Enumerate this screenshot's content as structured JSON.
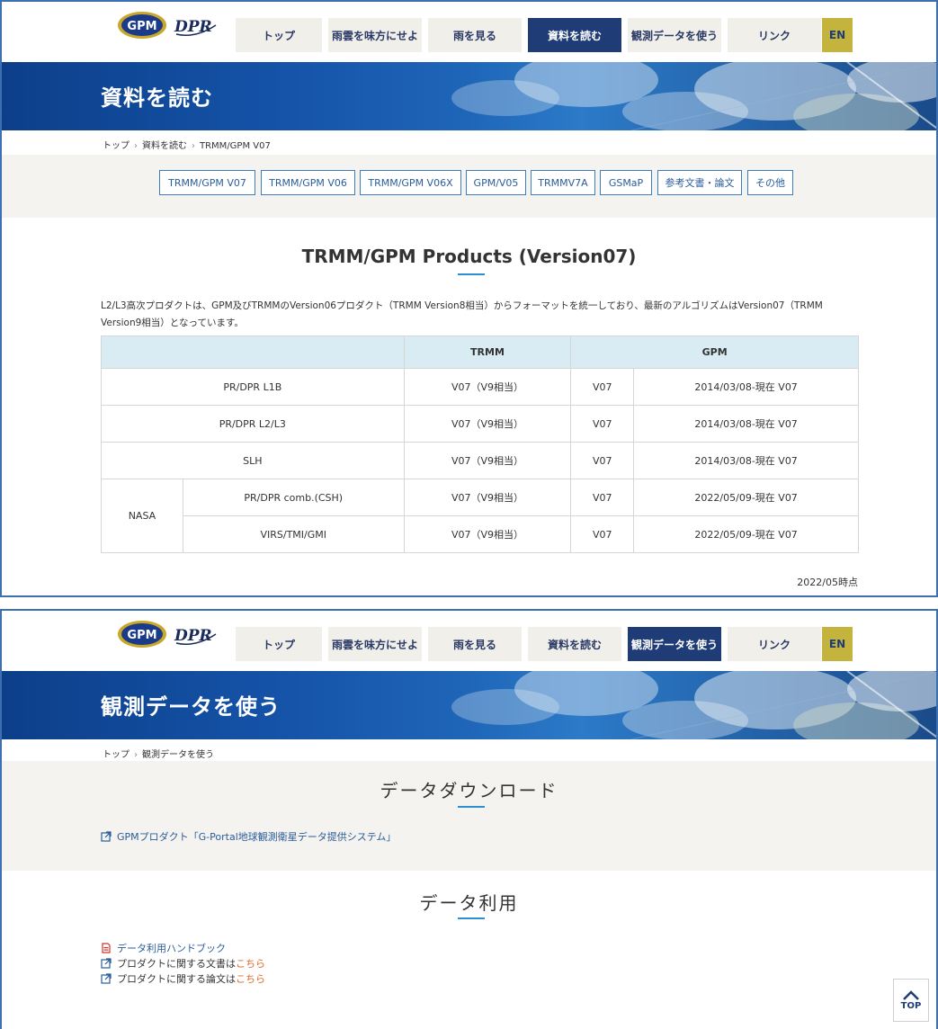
{
  "nav": {
    "logo_gpm_text": "GPM",
    "logo_dpr_text": "DPR",
    "items": [
      {
        "label": "トップ"
      },
      {
        "label": "雨雲を味方にせよ"
      },
      {
        "label": "雨を見る"
      },
      {
        "label": "資料を読む"
      },
      {
        "label": "観測データを使う"
      },
      {
        "label": "リンク"
      },
      {
        "label": "EN"
      }
    ]
  },
  "page1": {
    "hero_title": "資料を読む",
    "breadcrumb": [
      "トップ",
      "資料を読む",
      "TRMM/GPM V07"
    ],
    "subnav": [
      "TRMM/GPM V07",
      "TRMM/GPM V06",
      "TRMM/GPM V06X",
      "GPM/V05",
      "TRMMV7A",
      "GSMaP",
      "参考文書・論文",
      "その他"
    ],
    "section_title": "TRMM/GPM Products (Version07)",
    "intro": "L2/L3高次プロダクトは、GPM及びTRMMのVersion06プロダクト（TRMM Version8相当）からフォーマットを統一しており、最新のアルゴリズムはVersion07（TRMM Version9相当）となっています。",
    "table": {
      "headers": [
        "",
        "TRMM",
        "GPM"
      ],
      "rows": [
        {
          "label": "PR/DPR L1B",
          "trmm": "V07（V9相当）",
          "gpm_ver": "V07",
          "gpm_period": "2014/03/08-現在 V07"
        },
        {
          "label": "PR/DPR L2/L3",
          "trmm": "V07（V9相当）",
          "gpm_ver": "V07",
          "gpm_period": "2014/03/08-現在 V07"
        },
        {
          "label": "SLH",
          "trmm": "V07（V9相当）",
          "gpm_ver": "V07",
          "gpm_period": "2014/03/08-現在 V07"
        },
        {
          "group": "NASA",
          "label": "PR/DPR comb.(CSH)",
          "trmm": "V07（V9相当）",
          "gpm_ver": "V07",
          "gpm_period": "2022/05/09-現在 V07"
        },
        {
          "label": "VIRS/TMI/GMI",
          "trmm": "V07（V9相当）",
          "gpm_ver": "V07",
          "gpm_period": "2022/05/09-現在 V07"
        }
      ]
    },
    "as_of": "2022/05時点"
  },
  "page2": {
    "hero_title": "観測データを使う",
    "breadcrumb": [
      "トップ",
      "観測データを使う"
    ],
    "download_title": "データダウンロード",
    "download_link": "GPMプロダクト「G-Portal地球観測衛星データ提供システム」",
    "usage_title": "データ利用",
    "usage_links": [
      {
        "text": "データ利用ハンドブック",
        "icon": "pdf-icon"
      },
      {
        "text": "プロダクトに関する文書は",
        "here": "こちら",
        "icon": "external-link-icon"
      },
      {
        "text": "プロダクトに関する論文は",
        "here": "こちら",
        "icon": "external-link-icon"
      }
    ],
    "top_button": "TOP"
  }
}
